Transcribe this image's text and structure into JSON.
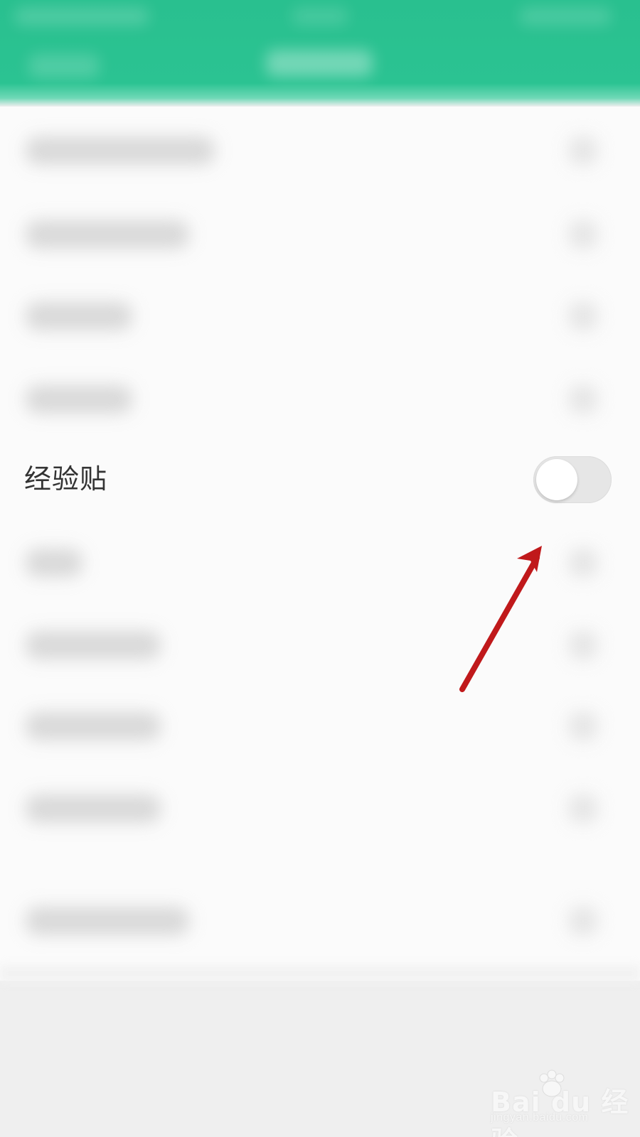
{
  "header": {
    "background_color": "#2bc392",
    "icons": {
      "back": "back-icon"
    }
  },
  "settings": {
    "visible_row": {
      "label": "经验贴",
      "toggle": {
        "state": "off",
        "knob_position": "left"
      }
    }
  },
  "overlay": {
    "arrow_color": "#c0191b",
    "arrow_target": "toggle-switch"
  },
  "watermark": {
    "brand_text": "Bai du 经验",
    "url_text": "jingyan.baidu.com"
  }
}
